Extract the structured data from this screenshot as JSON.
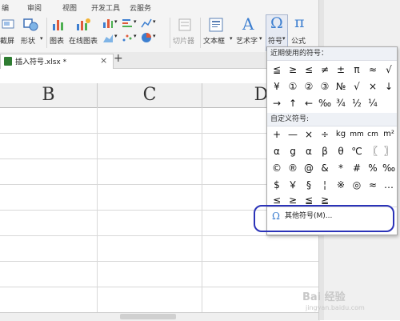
{
  "ribbon": {
    "tabs": [
      "编",
      "审阅",
      "视图",
      "开发工具",
      "云服务"
    ],
    "buttons": {
      "partial_left": "截屏",
      "shapes": "形状",
      "chart": "图表",
      "online_chart": "在线图表",
      "slicer": "切片器",
      "textbox": "文本框",
      "wordart": "艺术字",
      "symbol": "符号",
      "formula": "公式"
    },
    "wordart_glyph": "A",
    "symbol_glyph": "Ω",
    "formula_glyph": "π"
  },
  "file_tab": {
    "name": "插入符号.xlsx *",
    "close": "×",
    "new_tab": "+"
  },
  "columns": [
    "B",
    "C",
    "D"
  ],
  "symbol_menu": {
    "recent_title": "近期使用的符号：",
    "recent_symbols": [
      [
        "≦",
        "≥",
        "≤",
        "≠",
        "±",
        "π",
        "≈",
        "√"
      ],
      [
        "¥",
        "①",
        "②",
        "③",
        "№",
        "√",
        "×",
        "↓"
      ],
      [
        "→",
        "↑",
        "←",
        "‰",
        "¾",
        "½",
        "¼"
      ]
    ],
    "custom_title": "自定义符号:",
    "custom_symbols": [
      [
        "+",
        "—",
        "×",
        "÷",
        "kg",
        "mm",
        "cm",
        "m²"
      ],
      [
        "α",
        "g",
        "α",
        "β",
        "θ",
        "℃",
        "〖",
        "〗"
      ],
      [
        "©",
        "®",
        "@",
        "&",
        "*",
        "#",
        "%",
        "‰"
      ],
      [
        "$",
        "￥",
        "§",
        "¦",
        "※",
        "◎",
        "≈",
        "…"
      ],
      [
        "≤",
        "≥",
        "≦",
        "≧"
      ]
    ],
    "more_label": "其他符号(M)...",
    "more_icon": "Ω"
  },
  "watermark": {
    "text": "Bai 经验",
    "url": "jingyan.baidu.com"
  },
  "colors": {
    "accent": "#2f7d32",
    "highlight": "#2b33b8",
    "ribbon_bg": "#f4f4f4"
  }
}
